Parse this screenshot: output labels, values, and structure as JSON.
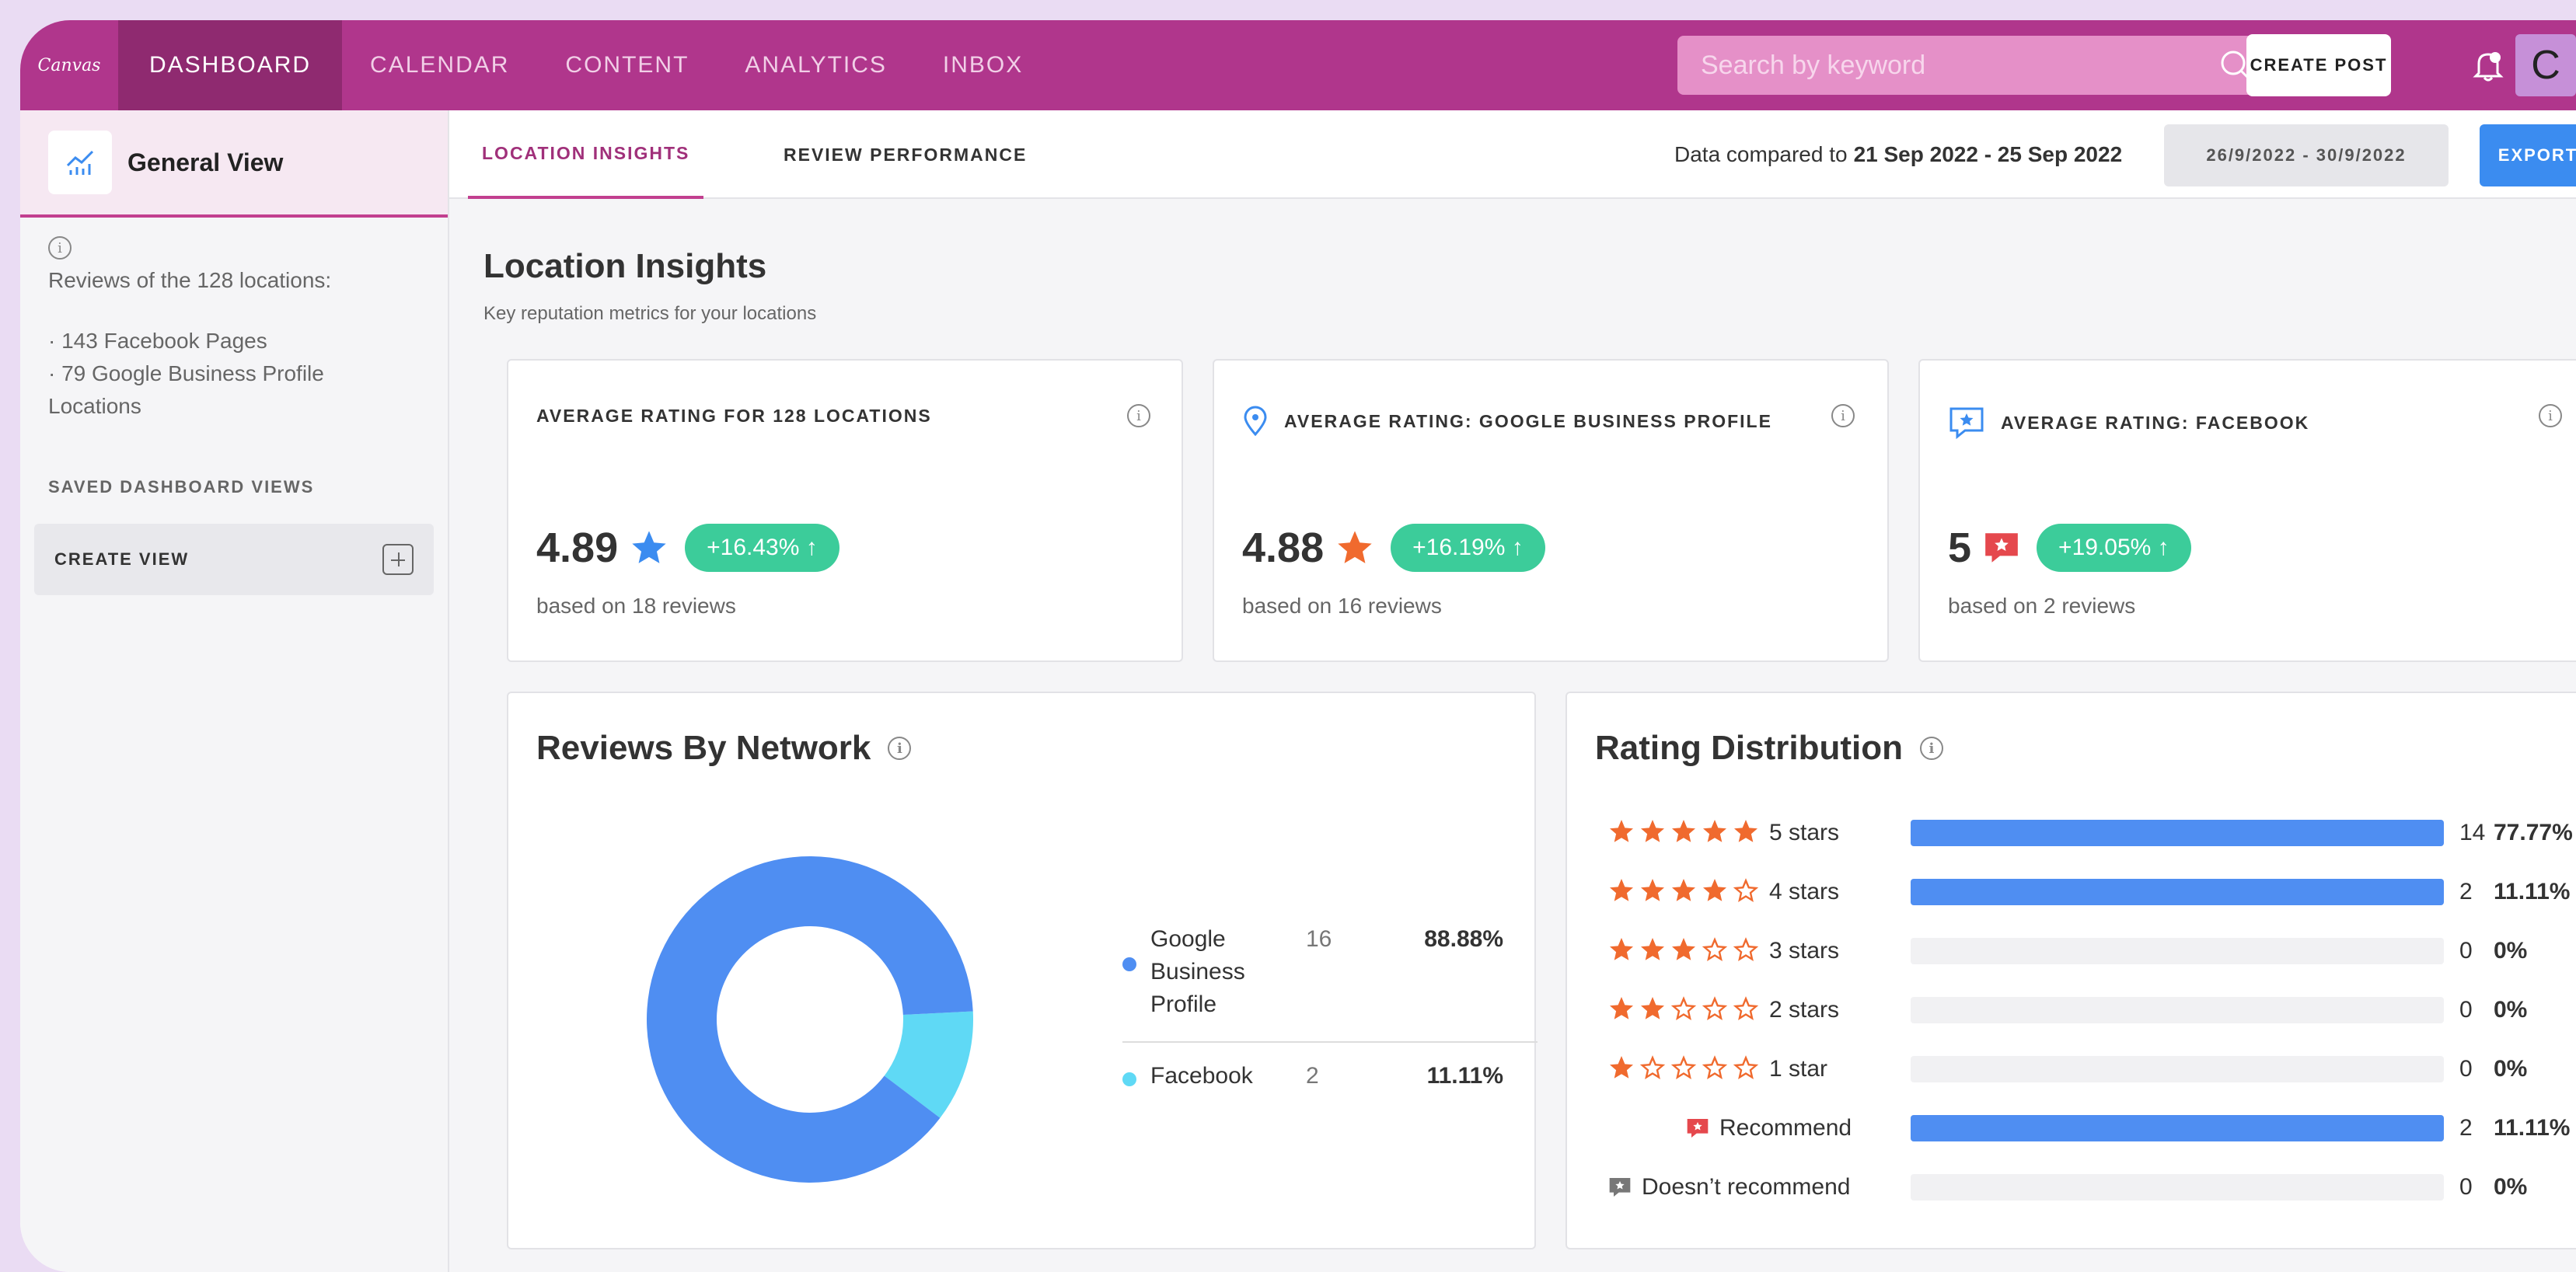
{
  "app": {
    "logo": "Canvas"
  },
  "nav": [
    {
      "label": "DASHBOARD",
      "active": true
    },
    {
      "label": "CALENDAR"
    },
    {
      "label": "CONTENT"
    },
    {
      "label": "ANALYTICS"
    },
    {
      "label": "INBOX"
    }
  ],
  "search": {
    "placeholder": "Search by keyword"
  },
  "header": {
    "create_post": "CREATE POST",
    "avatar_letter": "C"
  },
  "sidebar": {
    "general_view": "General View",
    "info_line": "Reviews of the 128 locations:",
    "facebook_pages": "· 143 Facebook Pages",
    "google_line1": "· 79 Google Business Profile",
    "google_line2": "Locations",
    "saved_title": "SAVED DASHBOARD VIEWS",
    "create_view": "CREATE VIEW"
  },
  "tabs": [
    {
      "label": "LOCATION INSIGHTS",
      "active": true
    },
    {
      "label": "REVIEW PERFORMANCE"
    }
  ],
  "compare": {
    "prefix": "Data compared to",
    "range": "21 Sep 2022 - 25 Sep 2022"
  },
  "date_range": "26/9/2022 - 30/9/2022",
  "export": "EXPORT",
  "page": {
    "title": "Location Insights",
    "subtitle": "Key reputation metrics for your locations"
  },
  "kpis": [
    {
      "title": "AVERAGE RATING FOR 128 LOCATIONS",
      "value": "4.89",
      "change": "+16.43% ↑",
      "sub": "based on 18 reviews",
      "icon": "star-icon",
      "color": "#3b8cf0"
    },
    {
      "title": "AVERAGE RATING: GOOGLE BUSINESS PROFILE",
      "value": "4.88",
      "change": "+16.19% ↑",
      "sub": "based on 16 reviews",
      "icon": "star-icon",
      "color": "#f06a2e"
    },
    {
      "title": "AVERAGE RATING: FACEBOOK",
      "value": "5",
      "change": "+19.05% ↑",
      "sub": "based on 2 reviews",
      "icon": "recommend-icon",
      "color": "#e5484d"
    }
  ],
  "reviews_by_network": {
    "title": "Reviews By Network",
    "rows": [
      {
        "name_lines": [
          "Google",
          "Business",
          "Profile"
        ],
        "count": "16",
        "pct": "88.88%",
        "color": "#4f8ef2"
      },
      {
        "name_lines": [
          "Facebook"
        ],
        "count": "2",
        "pct": "11.11%",
        "color": "#5fd9f5"
      }
    ]
  },
  "rating_distribution": {
    "title": "Rating Distribution",
    "rows": [
      {
        "label": "5 stars",
        "filled": 5,
        "count": "14",
        "pct": "77.77%",
        "fill": 1.0
      },
      {
        "label": "4 stars",
        "filled": 4,
        "count": "2",
        "pct": "11.11%",
        "fill": 1.0
      },
      {
        "label": "3 stars",
        "filled": 3,
        "count": "0",
        "pct": "0%",
        "fill": 0
      },
      {
        "label": "2 stars",
        "filled": 2,
        "count": "0",
        "pct": "0%",
        "fill": 0
      },
      {
        "label": "1 star",
        "filled": 1,
        "count": "0",
        "pct": "0%",
        "fill": 0
      },
      {
        "label": "Recommend",
        "count": "2",
        "pct": "11.11%",
        "fill": 1.0,
        "icon": "recommend-icon"
      },
      {
        "label": "Doesn’t recommend",
        "count": "0",
        "pct": "0%",
        "fill": 0,
        "icon": "not-recommend-icon"
      }
    ]
  },
  "chart_data": {
    "type": "pie",
    "categories": [
      "Google Business Profile",
      "Facebook"
    ],
    "values": [
      16,
      2
    ],
    "colors": [
      "#4f8ef2",
      "#5fd9f5"
    ],
    "donut": true
  }
}
